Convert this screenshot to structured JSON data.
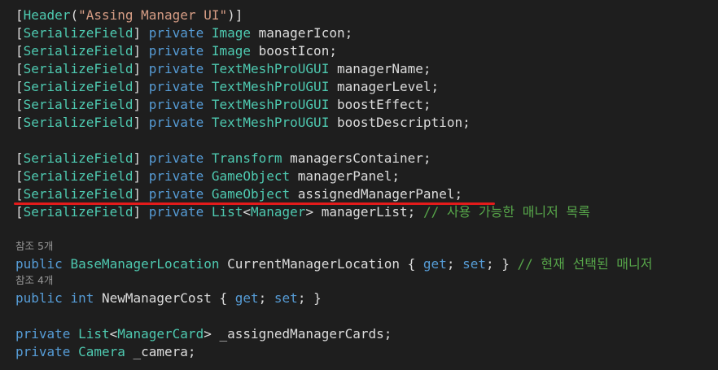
{
  "editor": {
    "lines": [
      {
        "id": "l1",
        "tokens": [
          {
            "c": "bracket",
            "t": "["
          },
          {
            "c": "attr",
            "t": "Header"
          },
          {
            "c": "bracket",
            "t": "("
          },
          {
            "c": "string",
            "t": "\"Assing Manager UI\""
          },
          {
            "c": "bracket",
            "t": ")]"
          }
        ]
      },
      {
        "id": "l2",
        "tokens": [
          {
            "c": "bracket",
            "t": "["
          },
          {
            "c": "attr",
            "t": "SerializeField"
          },
          {
            "c": "bracket",
            "t": "] "
          },
          {
            "c": "kw",
            "t": "private "
          },
          {
            "c": "type",
            "t": "Image "
          },
          {
            "c": "ident",
            "t": "managerIcon;"
          }
        ]
      },
      {
        "id": "l3",
        "tokens": [
          {
            "c": "bracket",
            "t": "["
          },
          {
            "c": "attr",
            "t": "SerializeField"
          },
          {
            "c": "bracket",
            "t": "] "
          },
          {
            "c": "kw",
            "t": "private "
          },
          {
            "c": "type",
            "t": "Image "
          },
          {
            "c": "ident",
            "t": "boostIcon;"
          }
        ]
      },
      {
        "id": "l4",
        "tokens": [
          {
            "c": "bracket",
            "t": "["
          },
          {
            "c": "attr",
            "t": "SerializeField"
          },
          {
            "c": "bracket",
            "t": "] "
          },
          {
            "c": "kw",
            "t": "private "
          },
          {
            "c": "type",
            "t": "TextMeshProUGUI "
          },
          {
            "c": "ident",
            "t": "managerName;"
          }
        ]
      },
      {
        "id": "l5",
        "tokens": [
          {
            "c": "bracket",
            "t": "["
          },
          {
            "c": "attr",
            "t": "SerializeField"
          },
          {
            "c": "bracket",
            "t": "] "
          },
          {
            "c": "kw",
            "t": "private "
          },
          {
            "c": "type",
            "t": "TextMeshProUGUI "
          },
          {
            "c": "ident",
            "t": "managerLevel;"
          }
        ]
      },
      {
        "id": "l6",
        "tokens": [
          {
            "c": "bracket",
            "t": "["
          },
          {
            "c": "attr",
            "t": "SerializeField"
          },
          {
            "c": "bracket",
            "t": "] "
          },
          {
            "c": "kw",
            "t": "private "
          },
          {
            "c": "type",
            "t": "TextMeshProUGUI "
          },
          {
            "c": "ident",
            "t": "boostEffect;"
          }
        ]
      },
      {
        "id": "l7",
        "tokens": [
          {
            "c": "bracket",
            "t": "["
          },
          {
            "c": "attr",
            "t": "SerializeField"
          },
          {
            "c": "bracket",
            "t": "] "
          },
          {
            "c": "kw",
            "t": "private "
          },
          {
            "c": "type",
            "t": "TextMeshProUGUI "
          },
          {
            "c": "ident",
            "t": "boostDescription;"
          }
        ]
      },
      {
        "id": "l8",
        "tokens": [
          {
            "c": "bracket",
            "t": "["
          },
          {
            "c": "attr",
            "t": "SerializeField"
          },
          {
            "c": "bracket",
            "t": "] "
          },
          {
            "c": "kw",
            "t": "private "
          },
          {
            "c": "type",
            "t": "Transform "
          },
          {
            "c": "ident",
            "t": "managersContainer;"
          }
        ]
      },
      {
        "id": "l9",
        "tokens": [
          {
            "c": "bracket",
            "t": "["
          },
          {
            "c": "attr",
            "t": "SerializeField"
          },
          {
            "c": "bracket",
            "t": "] "
          },
          {
            "c": "kw",
            "t": "private "
          },
          {
            "c": "type",
            "t": "GameObject "
          },
          {
            "c": "ident",
            "t": "managerPanel;"
          }
        ]
      },
      {
        "id": "l10",
        "tokens": [
          {
            "c": "bracket",
            "t": "["
          },
          {
            "c": "attr",
            "t": "SerializeField"
          },
          {
            "c": "bracket",
            "t": "] "
          },
          {
            "c": "kw",
            "t": "private "
          },
          {
            "c": "type",
            "t": "GameObject "
          },
          {
            "c": "ident",
            "t": "assignedManagerPanel;"
          }
        ]
      },
      {
        "id": "l11",
        "tokens": [
          {
            "c": "bracket",
            "t": "["
          },
          {
            "c": "attr",
            "t": "SerializeField"
          },
          {
            "c": "bracket",
            "t": "] "
          },
          {
            "c": "kw",
            "t": "private "
          },
          {
            "c": "type",
            "t": "List"
          },
          {
            "c": "ident",
            "t": "<"
          },
          {
            "c": "type",
            "t": "Manager"
          },
          {
            "c": "ident",
            "t": "> managerList; "
          },
          {
            "c": "comment",
            "t": "// 사용 가능한 매니저 목록"
          }
        ]
      },
      {
        "id": "l12",
        "tokens": [
          {
            "c": "kw",
            "t": "public "
          },
          {
            "c": "type",
            "t": "BaseManagerLocation "
          },
          {
            "c": "ident",
            "t": "CurrentManagerLocation { "
          },
          {
            "c": "kw",
            "t": "get"
          },
          {
            "c": "ident",
            "t": "; "
          },
          {
            "c": "kw",
            "t": "set"
          },
          {
            "c": "ident",
            "t": "; } "
          },
          {
            "c": "comment",
            "t": "// 현재 선택된 매니저"
          }
        ]
      },
      {
        "id": "l13",
        "tokens": [
          {
            "c": "kw",
            "t": "public "
          },
          {
            "c": "kw",
            "t": "int "
          },
          {
            "c": "ident",
            "t": "NewManagerCost { "
          },
          {
            "c": "kw",
            "t": "get"
          },
          {
            "c": "ident",
            "t": "; "
          },
          {
            "c": "kw",
            "t": "set"
          },
          {
            "c": "ident",
            "t": "; }"
          }
        ]
      },
      {
        "id": "l14",
        "tokens": [
          {
            "c": "kw",
            "t": "private "
          },
          {
            "c": "type",
            "t": "List"
          },
          {
            "c": "ident",
            "t": "<"
          },
          {
            "c": "type",
            "t": "ManagerCard"
          },
          {
            "c": "ident",
            "t": "> _assignedManagerCards;"
          }
        ]
      },
      {
        "id": "l15",
        "tokens": [
          {
            "c": "kw",
            "t": "private "
          },
          {
            "c": "type",
            "t": "Camera "
          },
          {
            "c": "ident",
            "t": "_camera;"
          }
        ]
      }
    ],
    "codelens": {
      "refs_current_manager_location": "참조 5개",
      "refs_new_manager_cost": "참조 4개"
    }
  },
  "colors": {
    "background": "#1e1e1e",
    "keyword": "#569cd6",
    "type": "#4ec9b0",
    "string": "#d69d85",
    "comment": "#57a64a",
    "identifier": "#dcdcdc",
    "codelens": "#999999",
    "highlight_underline": "#e31b1b"
  }
}
